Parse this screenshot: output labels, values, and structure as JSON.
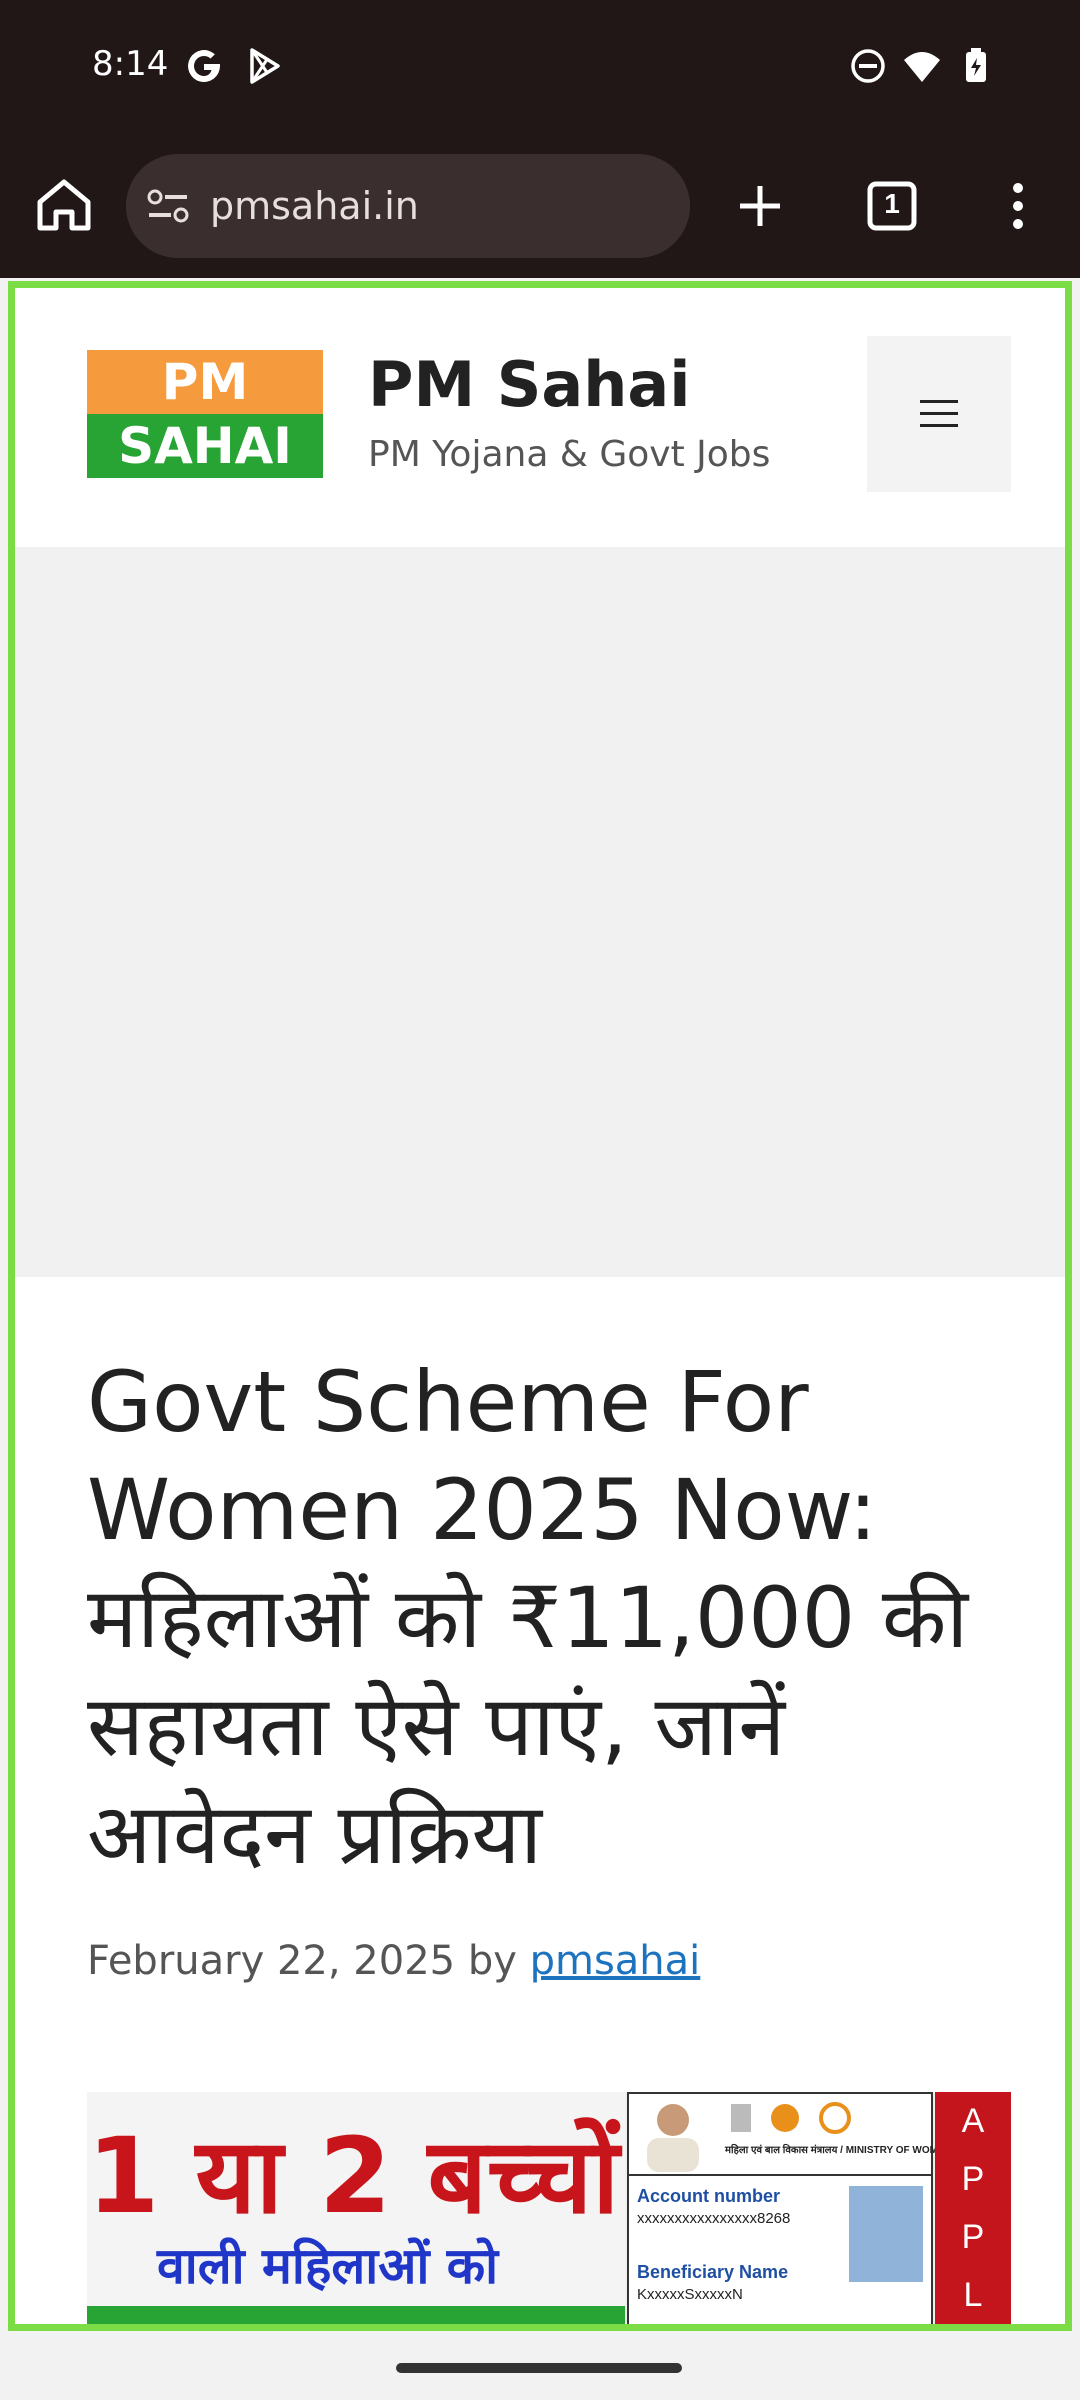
{
  "status_bar": {
    "time": "8:14",
    "left_icons": [
      "google-icon",
      "play-store-icon"
    ],
    "right_icons": [
      "do-not-disturb-icon",
      "wifi-icon",
      "battery-icon"
    ]
  },
  "browser": {
    "url": "pmsahai.in",
    "tab_count": "1",
    "icons": [
      "home-icon",
      "site-info-icon",
      "new-tab-icon",
      "tab-switcher-icon",
      "overflow-menu-icon"
    ]
  },
  "site": {
    "logo_top": "PM",
    "logo_bottom": "SAHAI",
    "title": "PM Sahai",
    "tagline": "PM Yojana & Govt Jobs"
  },
  "article": {
    "title": "Govt Scheme For Women 2025 Now: महिलाओं को ₹11,000 की सहायता ऐसे पाएं, जानें आवेदन प्रक्रिया",
    "date": "February 22, 2025",
    "by": "by",
    "author": "pmsahai"
  },
  "banner": {
    "headline": "1 या 2 बच्चों",
    "subline": "वाली महिलाओं को",
    "card_ministry": "महिला एवं बाल विकास मंत्रालय / MINISTRY OF WOMEN & CHILD DEVELOPMENT",
    "account_label": "Account number",
    "account_value": "xxxxxxxxxxxxxxxx8268",
    "beneficiary_label": "Beneficiary Name",
    "beneficiary_value": "KxxxxxSxxxxxN",
    "apply_text": "APPLY"
  },
  "colors": {
    "accent_green": "#27a433",
    "accent_orange": "#f59a3d",
    "focus_border": "#7bdc45",
    "link": "#1e73be",
    "banner_red": "#c8151c",
    "banner_blue": "#1f36c9"
  }
}
